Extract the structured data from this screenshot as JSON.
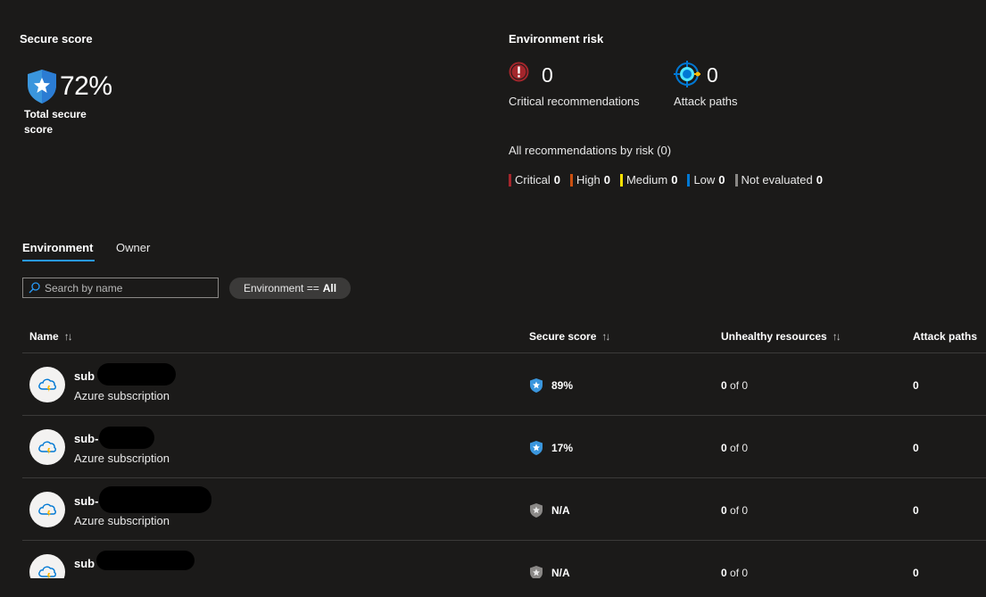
{
  "secure_score": {
    "title": "Secure score",
    "value": "72%",
    "caption": "Total secure score"
  },
  "environment_risk": {
    "title": "Environment risk",
    "critical_count": "0",
    "critical_label": "Critical recommendations",
    "attack_count": "0",
    "attack_label": "Attack paths",
    "all_by_risk_label": "All recommendations by risk (0)",
    "legend": [
      {
        "label": "Critical",
        "count": "0",
        "color": "#a4262c"
      },
      {
        "label": "High",
        "count": "0",
        "color": "#ca5010"
      },
      {
        "label": "Medium",
        "count": "0",
        "color": "#fce100"
      },
      {
        "label": "Low",
        "count": "0",
        "color": "#0078d4"
      },
      {
        "label": "Not evaluated",
        "count": "0",
        "color": "#8a8886"
      }
    ]
  },
  "tabs": [
    {
      "label": "Environment",
      "active": true
    },
    {
      "label": "Owner",
      "active": false
    }
  ],
  "filters": {
    "search_placeholder": "Search by name",
    "pill_key": "Environment ==",
    "pill_value": "All"
  },
  "table": {
    "columns": [
      "Name",
      "Secure score",
      "Unhealthy resources",
      "Attack paths"
    ],
    "rows": [
      {
        "name": "sub",
        "type": "Azure subscription",
        "score": "89%",
        "score_state": "scored",
        "unhealthy": "0",
        "unhealthy_of": "of 0",
        "attack_paths": "0"
      },
      {
        "name": "sub-",
        "type": "Azure subscription",
        "score": "17%",
        "score_state": "scored",
        "unhealthy": "0",
        "unhealthy_of": "of 0",
        "attack_paths": "0"
      },
      {
        "name": "sub-",
        "type": "Azure subscription",
        "score": "N/A",
        "score_state": "na",
        "unhealthy": "0",
        "unhealthy_of": "of 0",
        "attack_paths": "0"
      },
      {
        "name": "sub",
        "type": "",
        "score": "N/A",
        "score_state": "na",
        "unhealthy": "0",
        "unhealthy_of": "of 0",
        "attack_paths": "0"
      }
    ]
  },
  "colors": {
    "accent": "#2899f5",
    "shield_blue": "#3a96dd",
    "shield_gray": "#8a8886",
    "critical_red": "#a4262c"
  }
}
